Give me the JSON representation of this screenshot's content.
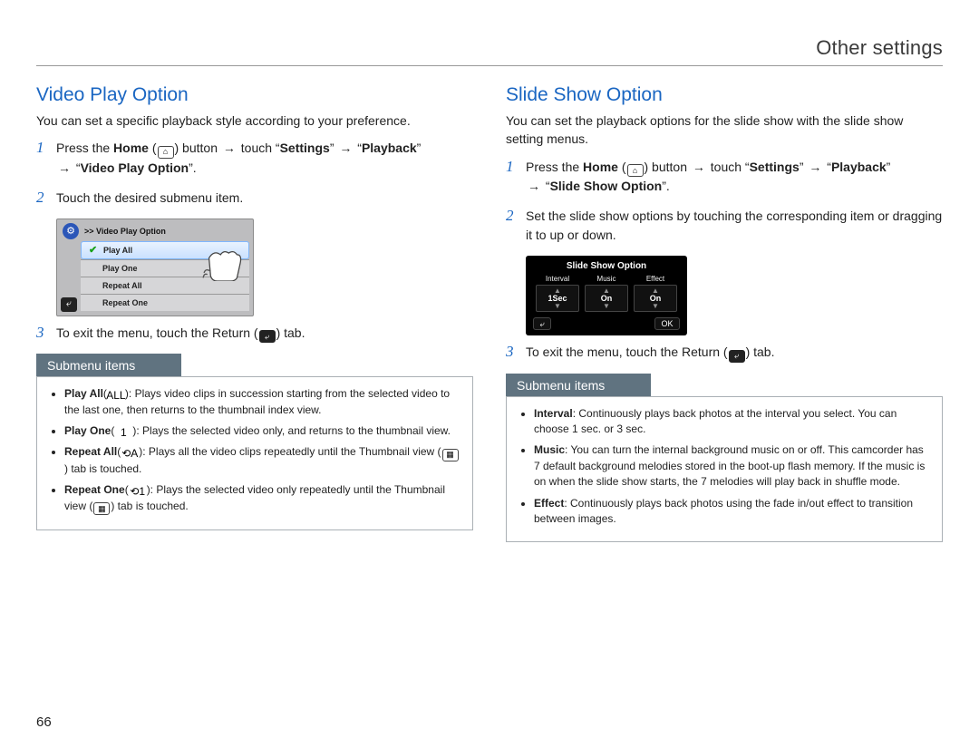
{
  "page": {
    "header": "Other settings",
    "number": "66"
  },
  "icons": {
    "home": "⌂",
    "arrow": "→",
    "return": "⤶",
    "thumb": "▦",
    "all": "ALL",
    "one": "1",
    "repAll": "⟲A",
    "repOne": "⟲1",
    "ok": "OK"
  },
  "left": {
    "title": "Video Play Option",
    "intro": "You can set a specific playback style according to your preference.",
    "s1a": "Press the ",
    "s1b": "Home",
    "s1c": " button ",
    "s1d": " touch “",
    "s1e": "Settings",
    "s1f": "” ",
    "s1g": " “",
    "s1h": "Playback",
    "s1i": "”",
    "s1j": " “",
    "s1k": "Video Play Option",
    "s1l": "”.",
    "s2": "Touch the desired submenu item.",
    "s3a": "To exit the menu, touch the Return (",
    "s3b": ") tab.",
    "shot": {
      "crumb": ">> Video Play Option",
      "items": [
        "Play All",
        "Play One",
        "Repeat All",
        "Repeat One"
      ]
    },
    "submenu": {
      "header": "Submenu items",
      "i1t": "Play All",
      "i1d": "): Plays video clips in succession starting from the selected video to the last one, then returns to the thumbnail index view.",
      "i2t": "Play One",
      "i2d": "): Plays the selected video only, and returns to the thumbnail view.",
      "i3t": "Repeat All",
      "i3d": "): Plays all the video clips repeatedly until the Thumbnail view (",
      "i3e": ") tab is touched.",
      "i4t": "Repeat One",
      "i4d": "): Plays the selected video only repeatedly until the Thumbnail view (",
      "i4e": ") tab is touched."
    }
  },
  "right": {
    "title": "Slide Show Option",
    "intro": "You can set the playback options for the slide show with the slide show setting menus.",
    "s1a": "Press the ",
    "s1b": "Home",
    "s1c": " button ",
    "s1d": " touch “",
    "s1e": "Settings",
    "s1f": "” ",
    "s1g": " “",
    "s1h": "Playback",
    "s1i": "”",
    "s1j": " “",
    "s1k": "Slide Show Option",
    "s1l": "”.",
    "s2": "Set the slide show options by touching the corresponding item or dragging it to up or down.",
    "s3a": "To exit the menu, touch the Return (",
    "s3b": ") tab.",
    "shot": {
      "title": "Slide Show Option",
      "cols": [
        {
          "label": "Interval",
          "value": "1Sec"
        },
        {
          "label": "Music",
          "value": "On"
        },
        {
          "label": "Effect",
          "value": "On"
        }
      ]
    },
    "submenu": {
      "header": "Submenu items",
      "i1t": "Interval",
      "i1d": ": Continuously plays back photos at the interval you select. You can choose 1 sec. or 3 sec.",
      "i2t": "Music",
      "i2d": ": You can turn the internal background music on or off. This camcorder has 7 default background melodies stored in the boot-up flash memory. If the music is on when the slide show starts, the 7 melodies will play back in shuffle mode.",
      "i3t": "Effect",
      "i3d": ": Continuously plays back photos using the fade in/out effect to transition between images."
    }
  }
}
